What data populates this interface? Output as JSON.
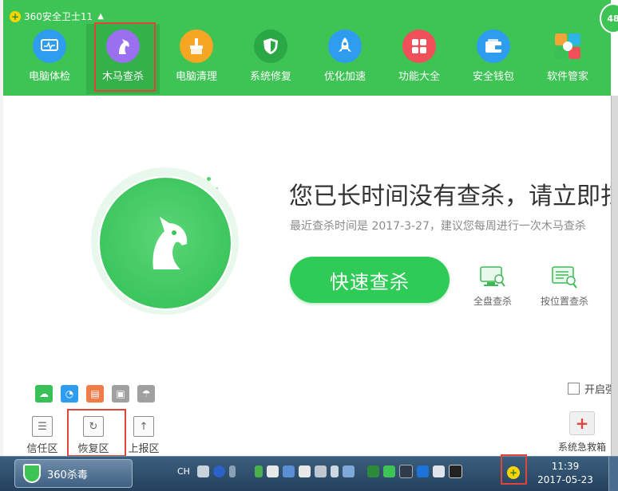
{
  "app": {
    "title": "360安全卫士11",
    "badge": "48",
    "colors": {
      "brand_green": "#3ec454",
      "button_green": "#2ecc56",
      "highlight_red": "#e0453c"
    }
  },
  "nav": {
    "items": [
      {
        "label": "电脑体检",
        "icon": "monitor-icon",
        "color": "#2e9df0"
      },
      {
        "label": "木马查杀",
        "icon": "horse-icon",
        "color": "#9a6ff0",
        "active": true
      },
      {
        "label": "电脑清理",
        "icon": "broom-icon",
        "color": "#f6a623"
      },
      {
        "label": "系统修复",
        "icon": "shield-icon",
        "color": "#2aa846"
      },
      {
        "label": "优化加速",
        "icon": "rocket-icon",
        "color": "#2e9df0"
      },
      {
        "label": "功能大全",
        "icon": "grid-icon",
        "color": "#f0505a"
      },
      {
        "label": "安全钱包",
        "icon": "wallet-icon",
        "color": "#2e9df0"
      },
      {
        "label": "软件管家",
        "icon": "apps-icon",
        "color": "#f2a33a"
      }
    ]
  },
  "main": {
    "headline": "您已长时间没有查杀，请立即扫",
    "subline": "最近查杀时间是 2017-3-27，建议您每周进行一次木马查杀",
    "quick_scan": "快速查杀",
    "full_scan": "全盘查杀",
    "custom_scan": "按位置查杀"
  },
  "bottom": {
    "trust": "信任区",
    "restore": "恢复区",
    "report": "上报区",
    "auto_protect": "开启强",
    "rescue": "系统急救箱"
  },
  "taskbar": {
    "app_label": "360杀毒",
    "ime": "CH",
    "time": "11:39",
    "date": "2017-05-23"
  }
}
